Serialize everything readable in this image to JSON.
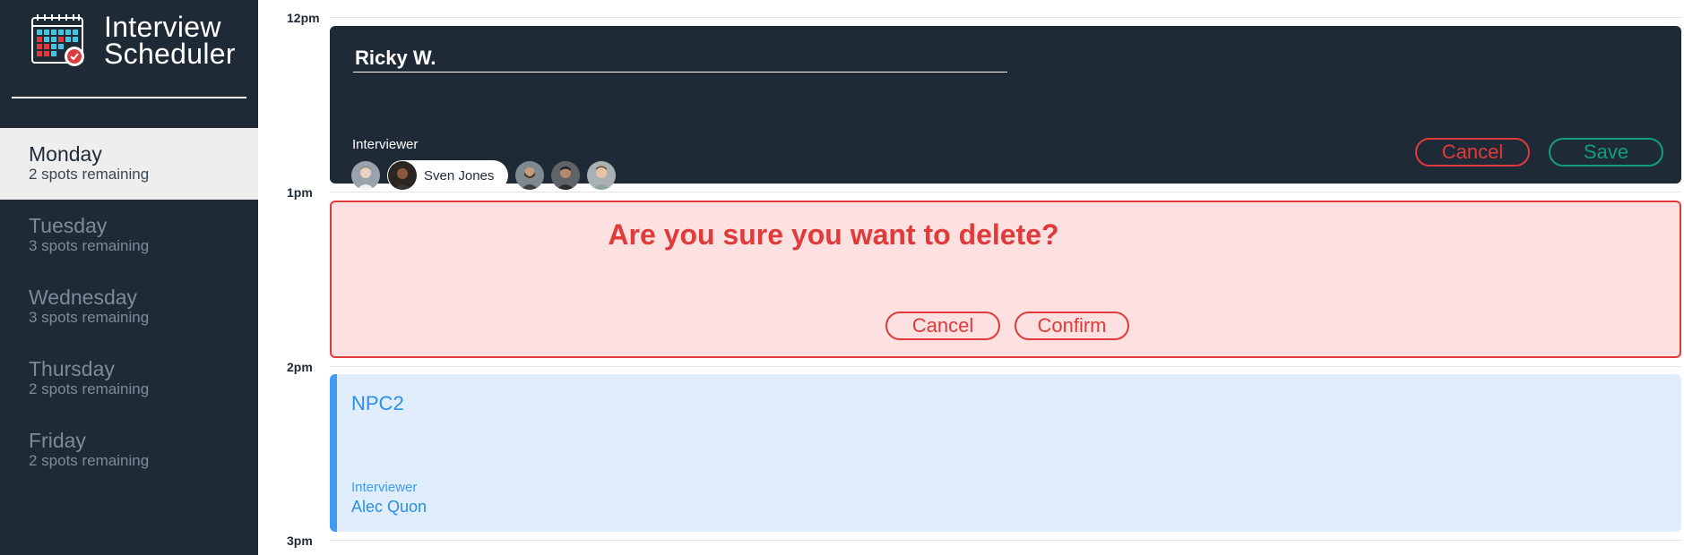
{
  "app": {
    "title_line1": "Interview",
    "title_line2": "Scheduler"
  },
  "sidebar": {
    "days": [
      {
        "name": "Monday",
        "spots": "2 spots remaining",
        "selected": true
      },
      {
        "name": "Tuesday",
        "spots": "3 spots remaining",
        "selected": false
      },
      {
        "name": "Wednesday",
        "spots": "3 spots remaining",
        "selected": false
      },
      {
        "name": "Thursday",
        "spots": "2 spots remaining",
        "selected": false
      },
      {
        "name": "Friday",
        "spots": "2 spots remaining",
        "selected": false
      }
    ]
  },
  "schedule": {
    "hours": [
      "12pm",
      "1pm",
      "2pm",
      "3pm"
    ],
    "edit_form": {
      "student_name": "Ricky W.",
      "interviewer_label": "Interviewer",
      "selected_interviewer": "Sven Jones",
      "cancel_label": "Cancel",
      "save_label": "Save"
    },
    "confirm": {
      "message": "Are you sure you want to delete?",
      "cancel_label": "Cancel",
      "confirm_label": "Confirm"
    },
    "appointment": {
      "student": "NPC2",
      "interviewer_label": "Interviewer",
      "interviewer_name": "Alec Quon"
    }
  },
  "colors": {
    "sidebar_bg": "#1f2a37",
    "danger": "#e03a3a",
    "success": "#0e9f7a",
    "info": "#3d9cf2"
  },
  "icons": {
    "logo": "calendar-check-icon",
    "avatars": [
      "person-avatar",
      "person-avatar",
      "person-avatar",
      "person-avatar",
      "person-avatar"
    ]
  }
}
